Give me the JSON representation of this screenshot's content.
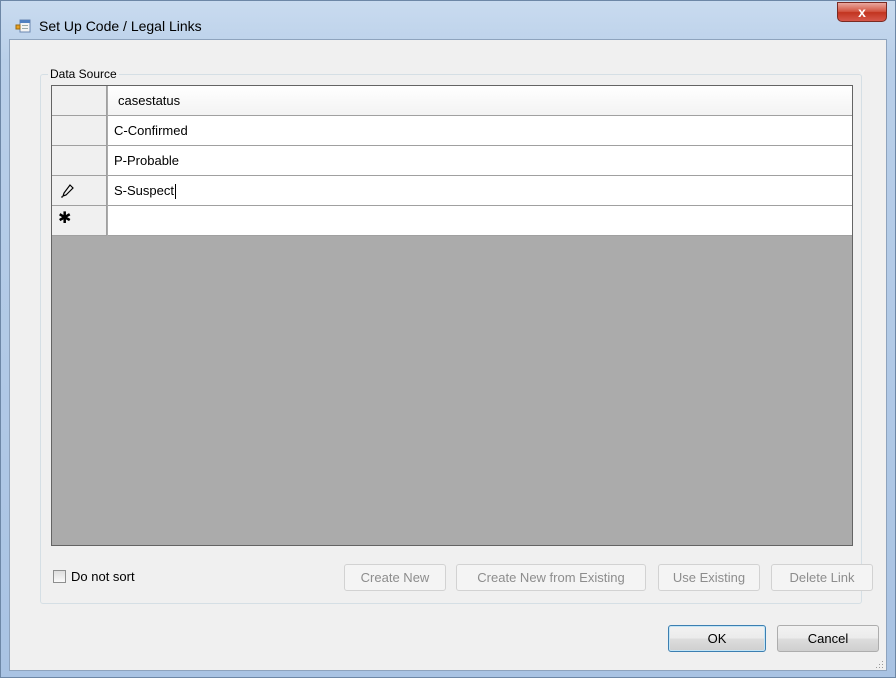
{
  "window": {
    "title": "Set Up Code / Legal Links",
    "close_glyph": "x"
  },
  "group": {
    "label": "Data Source"
  },
  "grid": {
    "column_header": "casestatus",
    "rows": [
      {
        "value": "C-Confirmed",
        "indicator": ""
      },
      {
        "value": "P-Probable",
        "indicator": ""
      },
      {
        "value": "S-Suspect",
        "indicator": "pencil-icon"
      },
      {
        "value": "",
        "indicator": "new-row-star-icon"
      }
    ]
  },
  "options": {
    "do_not_sort_label": "Do not sort",
    "do_not_sort_checked": false
  },
  "buttons": {
    "create_new": "Create New",
    "create_new_from_existing": "Create New from Existing",
    "use_existing": "Use Existing",
    "delete_link": "Delete Link",
    "ok": "OK",
    "cancel": "Cancel"
  },
  "colors": {
    "grid_background": "#ababab",
    "close_button": "#c9412f",
    "title_bar": "#b9cfe9"
  }
}
